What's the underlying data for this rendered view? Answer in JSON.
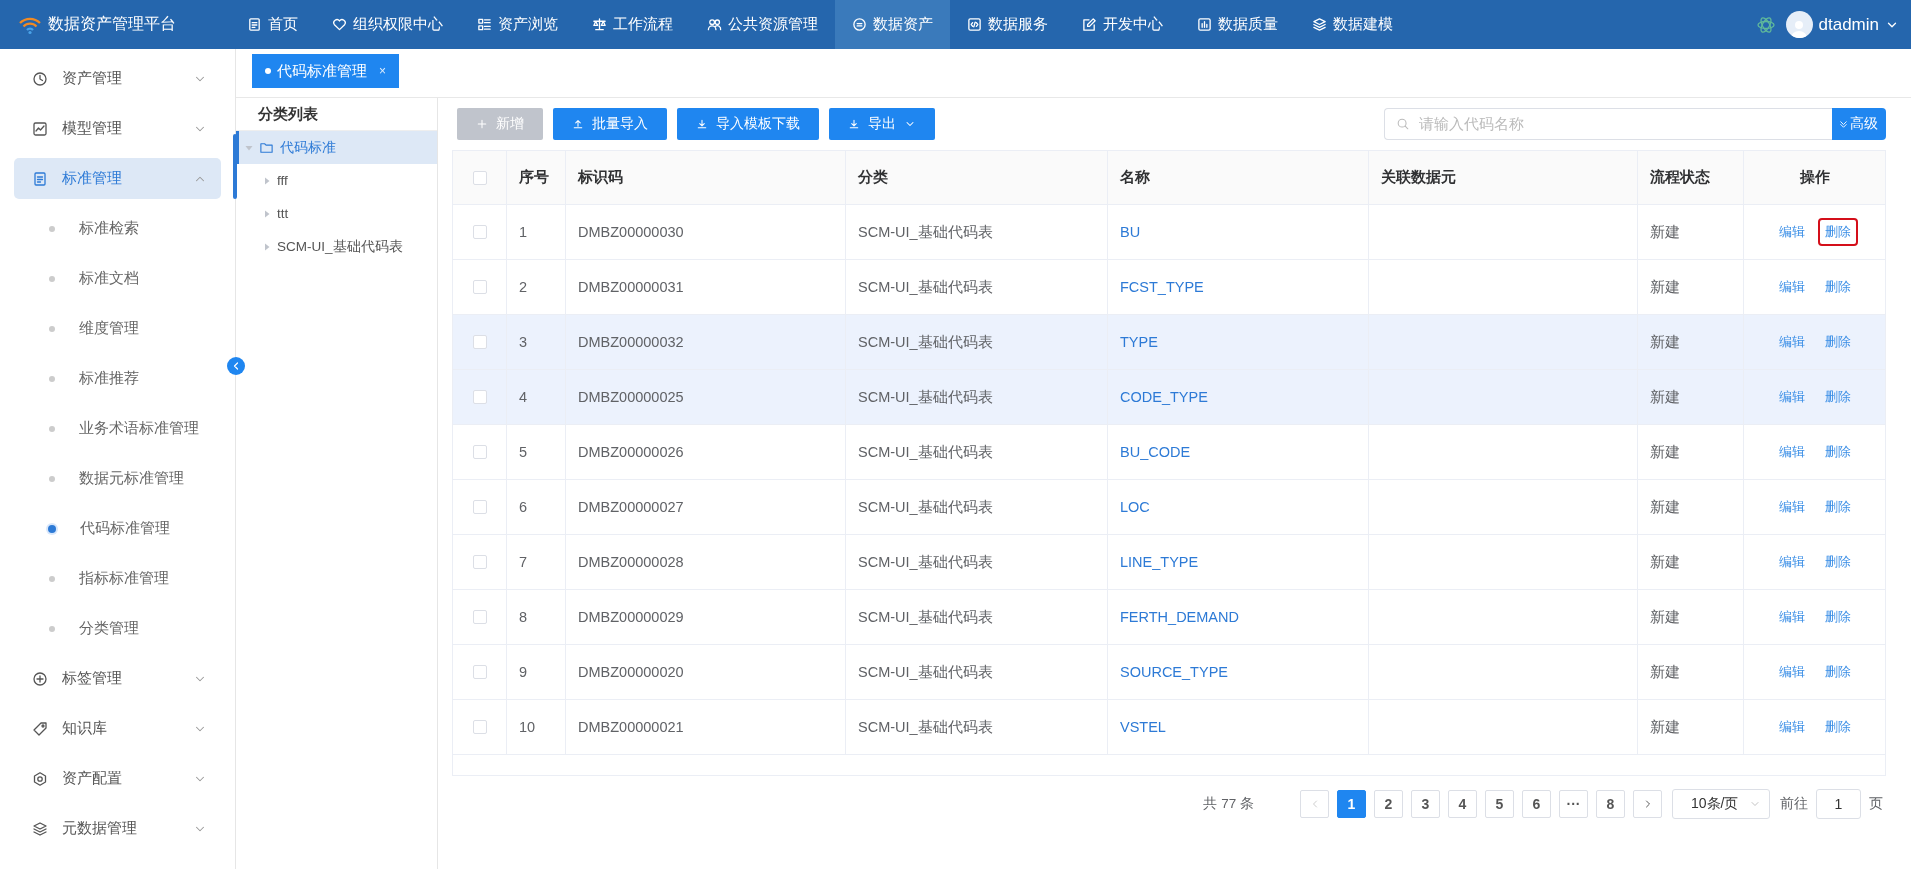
{
  "app": {
    "title": "数据资产管理平台"
  },
  "nav": [
    {
      "label": "首页",
      "selected": false
    },
    {
      "label": "组织权限中心",
      "selected": false
    },
    {
      "label": "资产浏览",
      "selected": false
    },
    {
      "label": "工作流程",
      "selected": false
    },
    {
      "label": "公共资源管理",
      "selected": false
    },
    {
      "label": "数据资产",
      "selected": true
    },
    {
      "label": "数据服务",
      "selected": false
    },
    {
      "label": "开发中心",
      "selected": false
    },
    {
      "label": "数据质量",
      "selected": false
    },
    {
      "label": "数据建模",
      "selected": false
    }
  ],
  "user": {
    "name": "dtadmin"
  },
  "sidebar": {
    "items": [
      {
        "label": "资产管理",
        "expanded": false,
        "selected": false
      },
      {
        "label": "模型管理",
        "expanded": false,
        "selected": false
      },
      {
        "label": "标准管理",
        "expanded": true,
        "selected": true,
        "children": [
          {
            "label": "标准检索",
            "selected": false
          },
          {
            "label": "标准文档",
            "selected": false
          },
          {
            "label": "维度管理",
            "selected": false
          },
          {
            "label": "标准推荐",
            "selected": false
          },
          {
            "label": "业务术语标准管理",
            "selected": false
          },
          {
            "label": "数据元标准管理",
            "selected": false
          },
          {
            "label": "代码标准管理",
            "selected": true
          },
          {
            "label": "指标标准管理",
            "selected": false
          },
          {
            "label": "分类管理",
            "selected": false
          }
        ]
      },
      {
        "label": "标签管理",
        "expanded": false,
        "selected": false
      },
      {
        "label": "知识库",
        "expanded": false,
        "selected": false
      },
      {
        "label": "资产配置",
        "expanded": false,
        "selected": false
      },
      {
        "label": "元数据管理",
        "expanded": false,
        "selected": false
      }
    ]
  },
  "tabs": [
    {
      "label": "代码标准管理",
      "selected": true,
      "close": "×"
    }
  ],
  "tree": {
    "title": "分类列表",
    "items": [
      {
        "label": "代码标准",
        "expanded": true,
        "selected": true,
        "children": [
          {
            "label": "fff",
            "expanded": false,
            "selected": false
          },
          {
            "label": "ttt",
            "expanded": false,
            "selected": false
          },
          {
            "label": "SCM-UI_基础代码表",
            "expanded": false,
            "selected": false
          }
        ]
      }
    ]
  },
  "toolbar": {
    "buttons": [
      {
        "label": "新增",
        "disabled": true,
        "dropdown": false
      },
      {
        "label": "批量导入",
        "disabled": false,
        "dropdown": false
      },
      {
        "label": "导入模板下载",
        "disabled": false,
        "dropdown": false
      },
      {
        "label": "导出",
        "disabled": false,
        "dropdown": true
      }
    ]
  },
  "search": {
    "placeholder": "请输入代码名称",
    "advanced": "高级"
  },
  "table": {
    "select_all_checked": false,
    "columns": [
      "序号",
      "标识码",
      "分类",
      "名称",
      "关联数据元",
      "流程状态",
      "操作"
    ],
    "rows": [
      {
        "checked": false,
        "highlighted": false,
        "index": "1",
        "code": "DMBZ00000030",
        "category": "SCM-UI_基础代码表",
        "name": "BU",
        "status": "新建",
        "actions": [
          {
            "label": "编辑",
            "outlined": false
          },
          {
            "label": "删除",
            "outlined": true
          }
        ]
      },
      {
        "checked": false,
        "highlighted": false,
        "index": "2",
        "code": "DMBZ00000031",
        "category": "SCM-UI_基础代码表",
        "name": "FCST_TYPE",
        "status": "新建",
        "actions": [
          {
            "label": "编辑",
            "outlined": false
          },
          {
            "label": "删除",
            "outlined": false
          }
        ]
      },
      {
        "checked": false,
        "highlighted": true,
        "index": "3",
        "code": "DMBZ00000032",
        "category": "SCM-UI_基础代码表",
        "name": "TYPE",
        "status": "新建",
        "actions": [
          {
            "label": "编辑",
            "outlined": false
          },
          {
            "label": "删除",
            "outlined": false
          }
        ]
      },
      {
        "checked": false,
        "highlighted": true,
        "index": "4",
        "code": "DMBZ00000025",
        "category": "SCM-UI_基础代码表",
        "name": "CODE_TYPE",
        "status": "新建",
        "actions": [
          {
            "label": "编辑",
            "outlined": false
          },
          {
            "label": "删除",
            "outlined": false
          }
        ]
      },
      {
        "checked": false,
        "highlighted": false,
        "index": "5",
        "code": "DMBZ00000026",
        "category": "SCM-UI_基础代码表",
        "name": "BU_CODE",
        "status": "新建",
        "actions": [
          {
            "label": "编辑",
            "outlined": false
          },
          {
            "label": "删除",
            "outlined": false
          }
        ]
      },
      {
        "checked": false,
        "highlighted": false,
        "index": "6",
        "code": "DMBZ00000027",
        "category": "SCM-UI_基础代码表",
        "name": "LOC",
        "status": "新建",
        "actions": [
          {
            "label": "编辑",
            "outlined": false
          },
          {
            "label": "删除",
            "outlined": false
          }
        ]
      },
      {
        "checked": false,
        "highlighted": false,
        "index": "7",
        "code": "DMBZ00000028",
        "category": "SCM-UI_基础代码表",
        "name": "LINE_TYPE",
        "status": "新建",
        "actions": [
          {
            "label": "编辑",
            "outlined": false
          },
          {
            "label": "删除",
            "outlined": false
          }
        ]
      },
      {
        "checked": false,
        "highlighted": false,
        "index": "8",
        "code": "DMBZ00000029",
        "category": "SCM-UI_基础代码表",
        "name": "FERTH_DEMAND",
        "status": "新建",
        "actions": [
          {
            "label": "编辑",
            "outlined": false
          },
          {
            "label": "删除",
            "outlined": false
          }
        ]
      },
      {
        "checked": false,
        "highlighted": false,
        "index": "9",
        "code": "DMBZ00000020",
        "category": "SCM-UI_基础代码表",
        "name": "SOURCE_TYPE",
        "status": "新建",
        "actions": [
          {
            "label": "编辑",
            "outlined": false
          },
          {
            "label": "删除",
            "outlined": false
          }
        ]
      },
      {
        "checked": false,
        "highlighted": false,
        "index": "10",
        "code": "DMBZ00000021",
        "category": "SCM-UI_基础代码表",
        "name": "VSTEL",
        "status": "新建",
        "actions": [
          {
            "label": "编辑",
            "outlined": false
          },
          {
            "label": "删除",
            "outlined": false
          }
        ]
      }
    ]
  },
  "pagination": {
    "total": "共 77 条",
    "prev_disabled": true,
    "next_disabled": false,
    "pages": [
      {
        "label": "1",
        "selected": true
      },
      {
        "label": "2",
        "selected": false
      },
      {
        "label": "3",
        "selected": false
      },
      {
        "label": "4",
        "selected": false
      },
      {
        "label": "5",
        "selected": false
      },
      {
        "label": "6",
        "selected": false
      },
      {
        "label": "···",
        "selected": false
      },
      {
        "label": "8",
        "selected": false
      }
    ],
    "page_size": "10条/页",
    "goto_label": "前往",
    "goto_value": "1",
    "page_unit": "页"
  }
}
